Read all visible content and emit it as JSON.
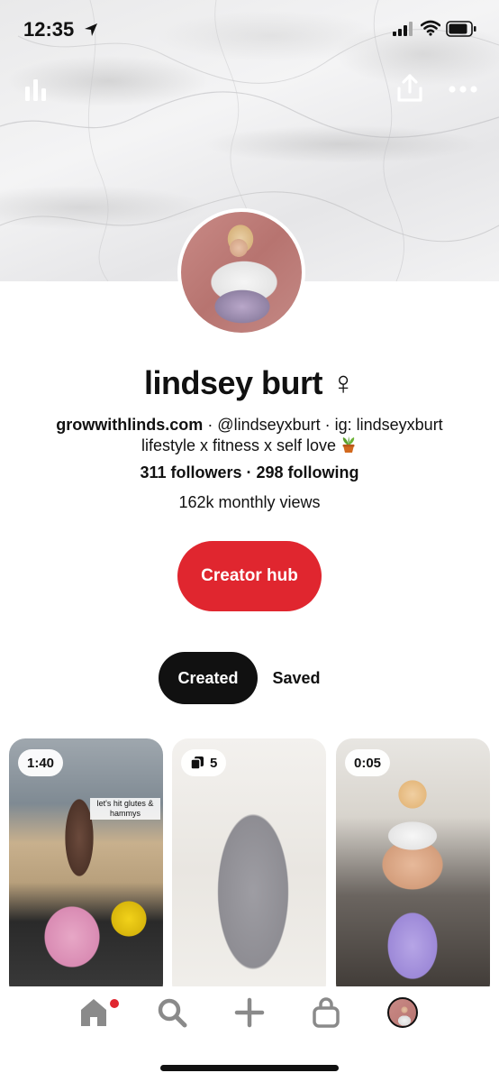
{
  "status_bar": {
    "time": "12:35"
  },
  "header": {
    "icons": [
      "stats-icon",
      "share-icon",
      "more-icon"
    ]
  },
  "profile": {
    "name": "lindsey burt ♀",
    "website": "growwithlinds.com",
    "bio_line1_rest": " · @lindseyxburt · ig: lindseyxburt",
    "bio_line2": "lifestyle x fitness x self love",
    "followers_text": "311 followers · 298 following",
    "monthly_views": "162k monthly views"
  },
  "actions": {
    "creator_hub_label": "Creator hub"
  },
  "tabs": {
    "created_label": "Created",
    "saved_label": "Saved"
  },
  "pins": [
    {
      "badge": "1:40",
      "caption": "let's hit glutes & hammys"
    },
    {
      "badge": "5"
    },
    {
      "badge": "0:05"
    }
  ],
  "colors": {
    "accent_red": "#e0262f",
    "active_tab_bg": "#111111"
  },
  "bottom_nav": [
    "home-icon",
    "search-icon",
    "add-icon",
    "shopping-bag-icon",
    "profile-avatar"
  ]
}
